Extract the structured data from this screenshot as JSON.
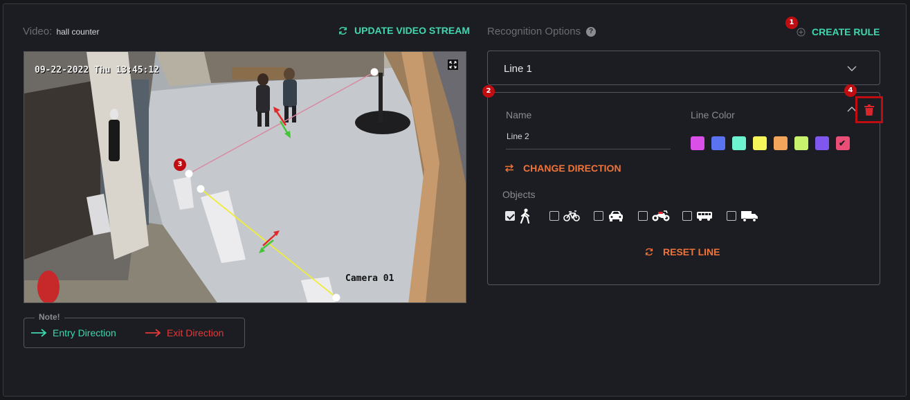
{
  "video": {
    "label": "Video:",
    "name": "hall counter",
    "update_label": "UPDATE VIDEO STREAM",
    "timestamp": "09-22-2022 Thu 13:45:12",
    "camera_label": "Camera 01"
  },
  "note": {
    "label": "Note!",
    "entry": "Entry Direction",
    "exit": "Exit Direction"
  },
  "recognition": {
    "title": "Recognition Options",
    "create_label": "CREATE RULE"
  },
  "badges": [
    "1",
    "2",
    "3",
    "4"
  ],
  "line1": {
    "label": "Line 1"
  },
  "line2": {
    "name_label": "Name",
    "name_value": "Line 2",
    "color_label": "Line Color",
    "colors": [
      "#d94fe8",
      "#5b73f0",
      "#6ef3d0",
      "#f6f55a",
      "#f4a55c",
      "#c8f26d",
      "#8057ee",
      "#ea4d76"
    ],
    "selected_color": "#ea4d76",
    "change_direction": "CHANGE DIRECTION",
    "objects_label": "Objects",
    "objects": [
      {
        "icon": "pedestrian-icon",
        "checked": true
      },
      {
        "icon": "bicycle-icon",
        "checked": false
      },
      {
        "icon": "car-icon",
        "checked": false
      },
      {
        "icon": "motorcycle-icon",
        "checked": false
      },
      {
        "icon": "bus-icon",
        "checked": false
      },
      {
        "icon": "truck-icon",
        "checked": false
      }
    ],
    "reset_label": "RESET LINE"
  },
  "colors": {
    "accent_green": "#3fd7b0",
    "accent_orange": "#f0733a",
    "exit_red": "#e2393b",
    "badge_red": "#c00d12"
  }
}
